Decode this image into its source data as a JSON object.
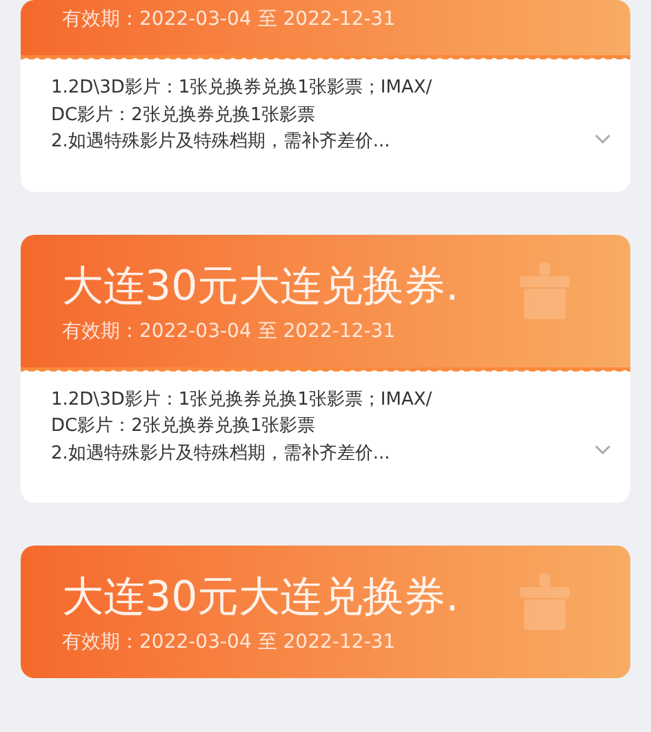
{
  "coupons": [
    {
      "validity": "有效期：2022-03-04 至 2022-12-31",
      "rules": [
        "1.2D\\3D影片：1张兑换券兑换1张影票；IMAX/",
        "DC影片：2张兑换券兑换1张影票",
        "2.如遇特殊影片及特殊档期，需补齐差价..."
      ]
    },
    {
      "title": "大连30元大连兑换券.",
      "validity": "有效期：2022-03-04 至 2022-12-31",
      "rules": [
        "1.2D\\3D影片：1张兑换券兑换1张影票；IMAX/",
        "DC影片：2张兑换券兑换1张影票",
        "2.如遇特殊影片及特殊档期，需补齐差价..."
      ]
    },
    {
      "title": "大连30元大连兑换券.",
      "validity": "有效期：2022-03-04 至 2022-12-31"
    }
  ]
}
